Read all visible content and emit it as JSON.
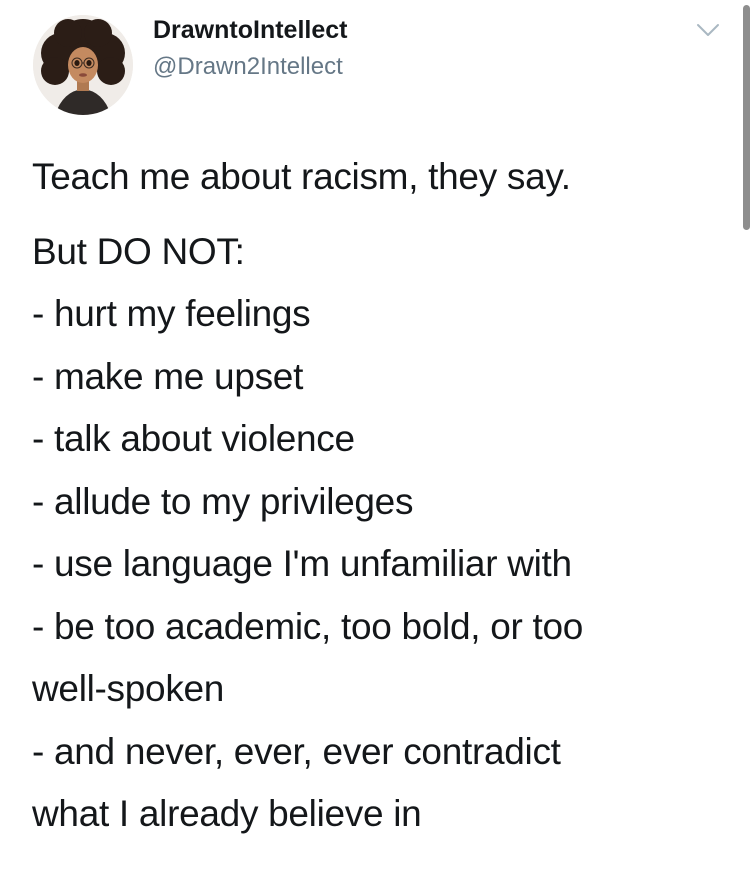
{
  "user": {
    "display_name": "DrawntoIntellect",
    "handle": "@Drawn2Intellect",
    "avatar_icon": "avatar-illustration"
  },
  "menu": {
    "icon": "chevron-down-icon"
  },
  "tweet": {
    "intro": "Teach me about racism, they say.",
    "heading": "But DO NOT:",
    "lines": [
      "- hurt my feelings",
      "- make me upset",
      "- talk about violence",
      "- allude to my privileges",
      "- use language I'm unfamiliar with",
      "- be too academic, too bold, or too",
      "well-spoken",
      "- and never, ever, ever contradict",
      "what I already believe in"
    ]
  },
  "colors": {
    "text": "#14171a",
    "handle": "#657786",
    "caret": "#aab8c2"
  }
}
